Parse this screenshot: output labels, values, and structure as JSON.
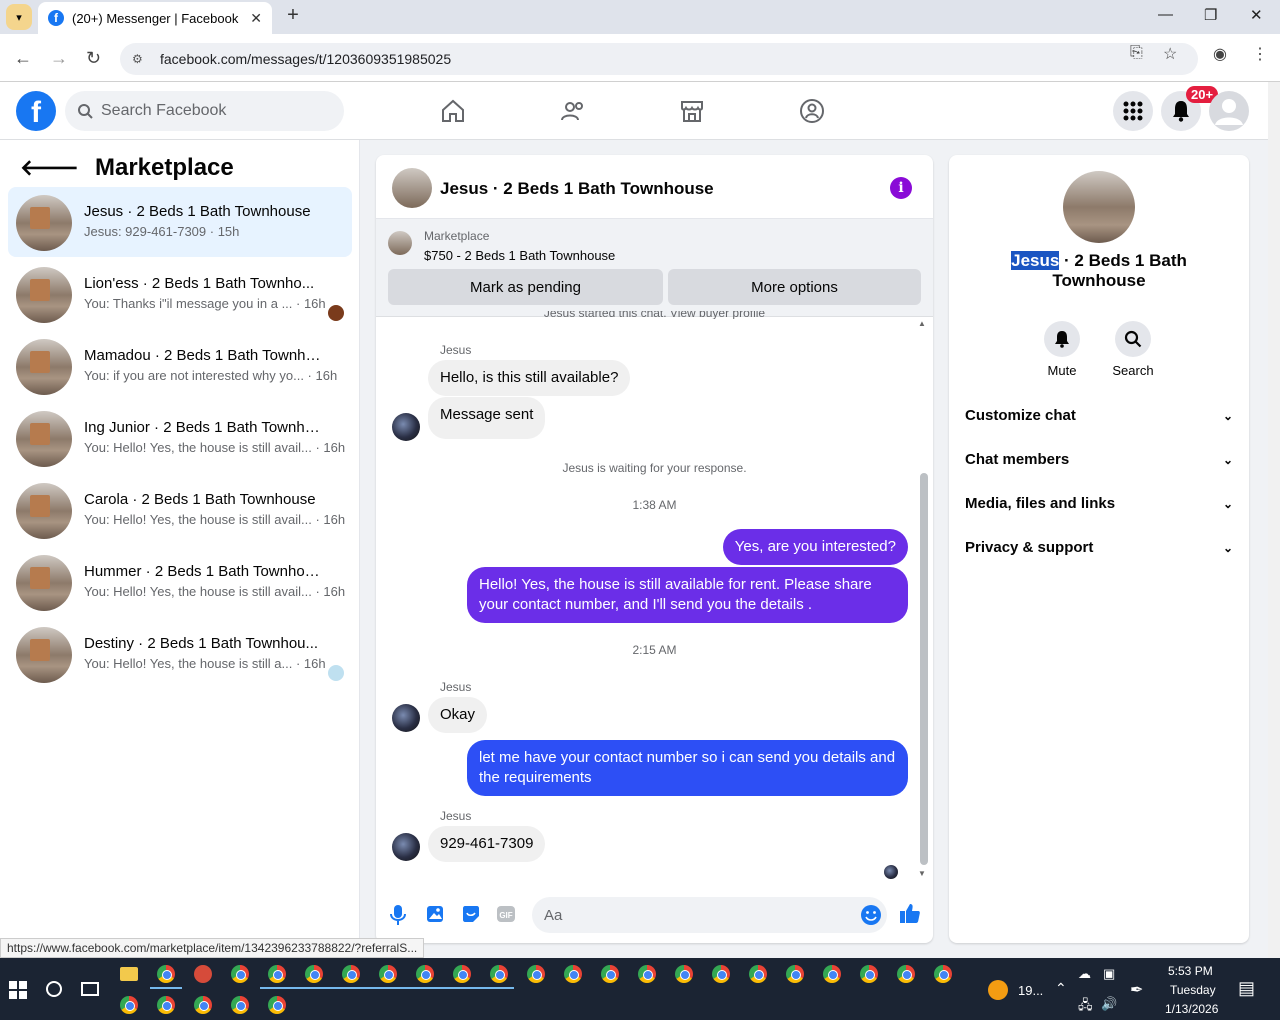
{
  "browser": {
    "tab_title": "(20+) Messenger | Facebook",
    "url": "facebook.com/messages/t/1203609351985025",
    "status_url": "https://www.facebook.com/marketplace/item/1342396233788822/?referralS..."
  },
  "header": {
    "search_placeholder": "Search Facebook",
    "notif_badge": "20+"
  },
  "sidebar": {
    "title": "Marketplace",
    "conversations": [
      {
        "name": "Jesus · 2 Beds 1 Bath Townhouse",
        "snippet": "Jesus: 929-461-7309 · 15h"
      },
      {
        "name": "Lion'ess · 2 Beds 1 Bath Townho...",
        "snippet": "You: Thanks i\"il message you in a ... · 16h"
      },
      {
        "name": "Mamadou · 2 Beds 1 Bath Townho...",
        "snippet": "You: if you are not interested why yo... · 16h"
      },
      {
        "name": "Ing Junior · 2 Beds 1 Bath Townho...",
        "snippet": "You: Hello! Yes, the house is still avail... · 16h"
      },
      {
        "name": "Carola · 2 Beds 1 Bath Townhouse",
        "snippet": "You: Hello! Yes, the house is still avail... · 16h"
      },
      {
        "name": "Hummer · 2 Beds 1 Bath Townhouse",
        "snippet": "You: Hello! Yes, the house is still avail... · 16h"
      },
      {
        "name": "Destiny · 2 Beds 1 Bath Townhou...",
        "snippet": "You: Hello! Yes, the house is still a... · 16h"
      }
    ]
  },
  "chat": {
    "title": "Jesus · 2 Beds 1 Bath Townhouse",
    "listing_label": "Marketplace",
    "listing_price": "$750 - 2 Beds 1 Bath Townhouse",
    "btn_pending": "Mark as pending",
    "btn_more": "More options",
    "partial_top": "Jesus started this chat. View buyer profile",
    "sender": "Jesus",
    "msg1": "Hello, is this still available?",
    "msg2": "Message sent",
    "waiting": "Jesus is waiting for your response.",
    "time1": "1:38 AM",
    "out1": "Yes, are you interested?",
    "out2": "Hello! Yes, the house is still available for rent. Please share your contact number, and I'll send you the details .",
    "time2": "2:15 AM",
    "msg3": "Okay",
    "out3": "let me have your contact number so i can send you details and the requirements",
    "msg4": "929-461-7309",
    "composer_placeholder": "Aa"
  },
  "details": {
    "name_selected": "Jesus",
    "name_rest": " · 2 Beds 1 Bath Townhouse",
    "mute": "Mute",
    "search": "Search",
    "sections": [
      "Customize chat",
      "Chat members",
      "Media, files and links",
      "Privacy & support"
    ]
  },
  "taskbar": {
    "weather": "19...",
    "time": "5:53 PM",
    "day": "Tuesday",
    "date": "1/13/2026"
  }
}
